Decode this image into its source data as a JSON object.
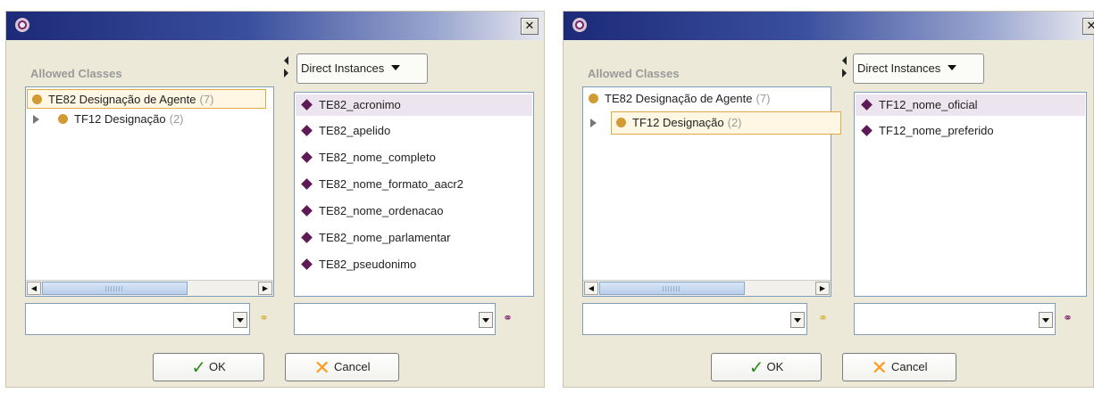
{
  "colors": {
    "titlebar_start": "#1c2a78",
    "class_dot": "#d19a33",
    "instance_diamond": "#5e1a55",
    "selection_border": "#e0a947",
    "ok_check": "#2f8a1f",
    "cancel_x": "#ff9a1a"
  },
  "dialogs": [
    {
      "title_icon": "protege-logo-icon",
      "close_label": "✕",
      "allowed_classes_label": "Allowed Classes",
      "classes": [
        {
          "name": "TE82 Designação de Agente",
          "count": "(7)",
          "selected": true,
          "expandable": false
        },
        {
          "name": "TF12 Designação",
          "count": "(2)",
          "selected": false,
          "expandable": true
        }
      ],
      "view_selector_label": "Direct Instances",
      "instances": [
        {
          "name": "TE82_acronimo",
          "selected": true
        },
        {
          "name": "TE82_apelido",
          "selected": false
        },
        {
          "name": "TE82_nome_completo",
          "selected": false
        },
        {
          "name": "TE82_nome_formato_aacr2",
          "selected": false
        },
        {
          "name": "TE82_nome_ordenacao",
          "selected": false
        },
        {
          "name": "TE82_nome_parlamentar",
          "selected": false
        },
        {
          "name": "TE82_pseudonimo",
          "selected": false
        }
      ],
      "class_search_value": "",
      "instance_search_value": "",
      "ok_label": "OK",
      "cancel_label": "Cancel"
    },
    {
      "title_icon": "protege-logo-icon",
      "close_label": "✕",
      "allowed_classes_label": "Allowed Classes",
      "classes": [
        {
          "name": "TE82 Designação de Agente",
          "count": "(7)",
          "selected": false,
          "expandable": false
        },
        {
          "name": "TF12 Designação",
          "count": "(2)",
          "selected": true,
          "expandable": true
        }
      ],
      "view_selector_label": "Direct Instances",
      "instances": [
        {
          "name": "TF12_nome_oficial",
          "selected": true
        },
        {
          "name": "TF12_nome_preferido",
          "selected": false
        }
      ],
      "class_search_value": "",
      "instance_search_value": "",
      "ok_label": "OK",
      "cancel_label": "Cancel"
    }
  ]
}
